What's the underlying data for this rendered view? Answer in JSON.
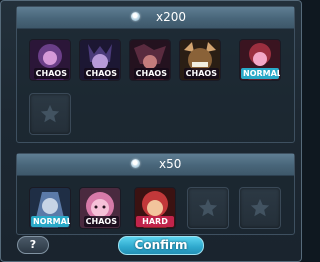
{
  "reward_groups": [
    {
      "count": "x200",
      "bosses": [
        {
          "difficulty": "CHAOS",
          "colors": [
            "#2b1638",
            "#6b3f88",
            "#d59ad8"
          ]
        },
        {
          "difficulty": "CHAOS",
          "colors": [
            "#1c1733",
            "#4a3b7a",
            "#b79ad8"
          ]
        },
        {
          "difficulty": "CHAOS",
          "colors": [
            "#24121f",
            "#5a2b3f",
            "#c47c7c"
          ]
        },
        {
          "difficulty": "CHAOS",
          "colors": [
            "#2a1e14",
            "#8a6238",
            "#d3a571"
          ]
        },
        {
          "difficulty": "NORMAL",
          "colors": [
            "#3a1420",
            "#9b2f3f",
            "#f3a8c6"
          ]
        }
      ],
      "empty_slots": 1
    },
    {
      "count": "x50",
      "bosses": [
        {
          "difficulty": "NORMAL",
          "colors": [
            "#1f2e45",
            "#5b7aa8",
            "#c7d4e6"
          ]
        },
        {
          "difficulty": "CHAOS",
          "colors": [
            "#4a2a3f",
            "#d77aa8",
            "#f6c1d8"
          ]
        },
        {
          "difficulty": "HARD",
          "colors": [
            "#3b1212",
            "#c2383a",
            "#f2c49c"
          ]
        }
      ],
      "empty_slots": 2
    }
  ],
  "buttons": {
    "help_label": "?",
    "confirm_label": "Confirm"
  },
  "icons": {
    "empty_slot": "star-icon",
    "group_marker": "bullet-icon"
  }
}
